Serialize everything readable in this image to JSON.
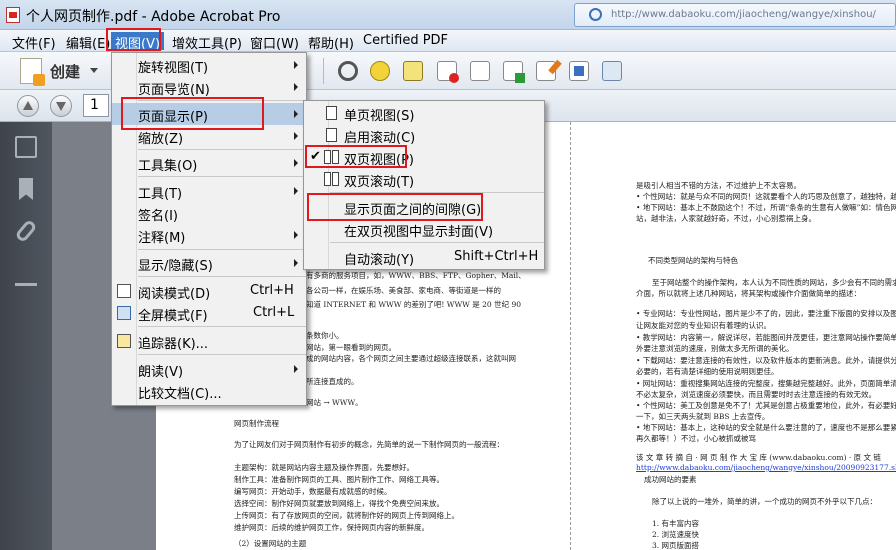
{
  "window": {
    "title": "个人网页制作.pdf - Adobe Acrobat Pro",
    "url_text": "http://www.dabaoku.com/jiaocheng/wangye/xinshou/"
  },
  "menubar": [
    {
      "label": "文件(F)"
    },
    {
      "label": "编辑(E)"
    },
    {
      "label": "视图(V)"
    },
    {
      "label": "增效工具(P)"
    },
    {
      "label": "窗口(W)"
    },
    {
      "label": "帮助(H)"
    },
    {
      "label": "Certified PDF"
    }
  ],
  "toolbar": {
    "create_label": "创建",
    "page_number": "1"
  },
  "view_menu": {
    "items": [
      {
        "label": "旋转视图(T)",
        "submenu": true
      },
      {
        "label": "页面导览(N)",
        "submenu": true
      },
      {
        "label": "页面显示(P)",
        "submenu": true
      },
      {
        "label": "缩放(Z)",
        "submenu": true
      },
      {
        "label": "工具集(O)",
        "submenu": true
      },
      {
        "label": "工具(T)",
        "submenu": true
      },
      {
        "label": "签名(I)",
        "submenu": false
      },
      {
        "label": "注释(M)",
        "submenu": true
      },
      {
        "label": "显示/隐藏(S)",
        "submenu": true
      },
      {
        "label": "阅读模式(D)",
        "shortcut": "Ctrl+H"
      },
      {
        "label": "全屏模式(F)",
        "shortcut": "Ctrl+L"
      },
      {
        "label": "追踪器(K)..."
      },
      {
        "label": "朗读(V)",
        "submenu": true
      },
      {
        "label": "比较文档(C)..."
      }
    ]
  },
  "page_display_submenu": {
    "items": [
      {
        "label": "单页视图(S)"
      },
      {
        "label": "启用滚动(C)"
      },
      {
        "label": "双页视图(P)",
        "checked": true
      },
      {
        "label": "双页滚动(T)"
      },
      {
        "label": "显示页面之间的间隙(G)"
      },
      {
        "label": "在双页视图中显示封面(V)"
      },
      {
        "label": "自动滚动(Y)",
        "shortcut": "Shift+Ctrl+H"
      }
    ]
  },
  "left_page_lines": [
    "有多商的服务项目，如，WWW、BBS、FTP、Gopher、Mail、",
    "各公司一样，在娱乐场、美食部、家电商、等街道是一样的",
    "知道 INTERNET 和 WWW 的差别了吧! WWW 是 20 世纪 90",
    "条数你小。",
    "网站，第一眼看到的网页。",
    "成的网站内容，各个网页之间主要通过超级连接联系，这就叫网",
    "所连接直成的。",
    "网站 → WWW。",
    "网页制作流程",
    "为了让网友们对于网页制作有初步的概念，先简单的说一下制作网页的一般流程：",
    "主题架构：就是网站内容主题及操作界面，先要想好。",
    "制作工具：准备制作网页的工具、图片制作工作、网络工具等。",
    "编写网页：开始动手，数据最有成就感的时候。",
    "选择空间：制作好网页就要放到网络上，得找个免费空间来放。",
    "上传网页：有了存放网页的空间，就将制作好的网页上传到网络上。",
    "维护网页：后续的维护网页工作，保持网页内容的新鲜度。",
    "（2）设置网站的主题"
  ],
  "right_page_lines": [
    "是吸引人相当不错的方法，不过维护上不太容易。",
    "• 个性网站：就是与众不同的网页！这就要看个人的巧思及创意了，越独特，越吸",
    "• 地下网站：基本上不鼓励这个！不过，所谓“条条的生意有人做嘛”如：情色网",
    "站，越非法，人家就越好奇，不过，小心别惹祸上身。",
    "不同类型网站的架构与特色",
    "至于网站整个的操作架构，本人认为不同性质的网站，多少会有不同的需求",
    "介面，所以就将上述几种网站，将其架构或操作介面做简单的描述：",
    "• 专业网站：专业性网站，图片是少不了的，因此，要注重下版面的安排以及图片",
    "让网友能对您的专业知识有着理的认识。",
    "• 教学网站：内容第一，解说详尽，若能图间并茂更佳，更注意网站操作要简单",
    "外要注意浏览的速度，别做太多无所谓的美化。",
    "• 下载网站：要注意连接的有效性，以及软件版本的更新消息。此外，请提供分",
    "必要的，若有清楚详细的使用说明则更佳。",
    "• 网址网站：重视搜集网站连接的完整度，搜集越完整越好。此外，页面简单清",
    "不必太复杂，浏览速度必须要快，而且需要时时去注意连接的有效无效。",
    "• 个性网站：美工及创意是免不了！尤其是创意占极重要地位，此外，有必要好好",
    "一下，如三天两头就到 BBS 上去宣传。",
    "• 地下网站：基本上，这种站的安全就是什么要注意的了，速度也不是那么要紧（为了这",
    "再久都等！）不过，小心被抓或被骂",
    "该 文 章 转 摘 自 · 网 页 制 作 大 宝 库 (www.dabaoku.com) · 原 文 链",
    "http://www.dabaoku.com/jiaocheng/wangye/xinshou/20090923177.shtml",
    "成功网站的要素",
    "除了以上说的一堆外，简单的讲，一个成功的网页不外乎以下几点：",
    "1. 有丰富内容",
    "2. 浏览速度快",
    "3. 网页版面搭"
  ]
}
